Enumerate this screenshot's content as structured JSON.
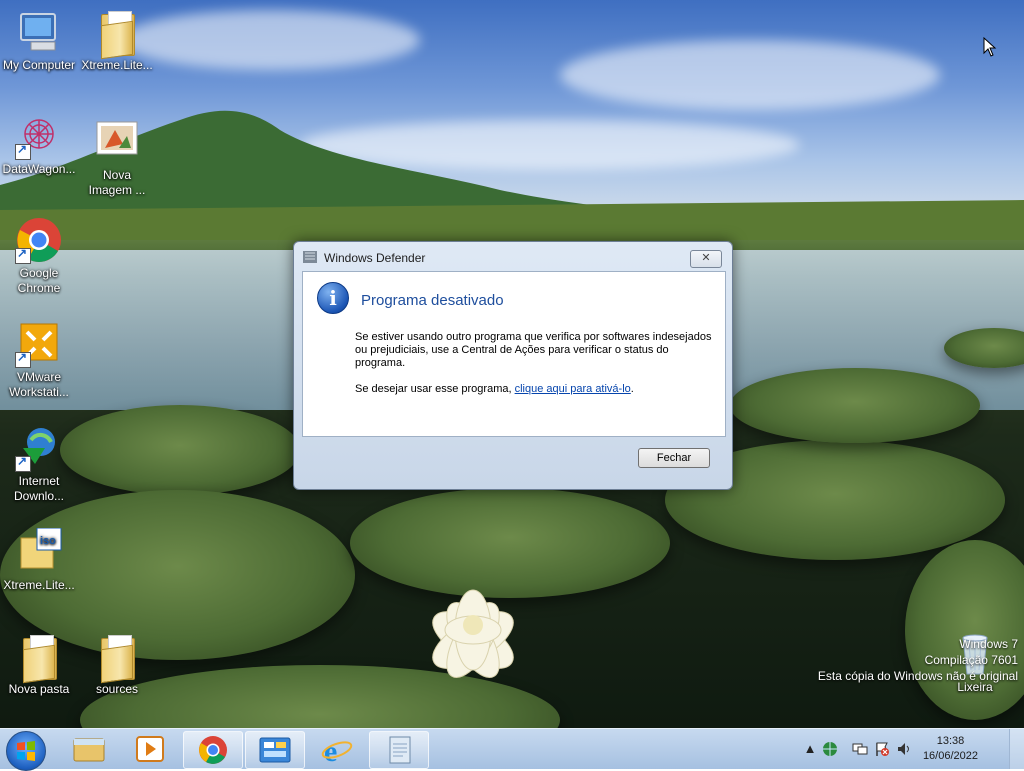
{
  "desktop": {
    "icons": [
      {
        "label": "My Computer"
      },
      {
        "label": "Xtreme.Lite..."
      },
      {
        "label": "DataWagon..."
      },
      {
        "label": "Nova\nImagem ..."
      },
      {
        "label": "Google\nChrome"
      },
      {
        "label": "VMware\nWorkstati..."
      },
      {
        "label": "Internet\nDownlo..."
      },
      {
        "label": "Xtreme.Lite..."
      },
      {
        "label": "Nova pasta"
      },
      {
        "label": "sources"
      },
      {
        "label": "Lixeira"
      }
    ]
  },
  "watermark": {
    "line1": "Windows 7",
    "line2": "Compilação 7601",
    "line3": "Esta cópia do Windows não é original"
  },
  "dialog": {
    "title": "Windows Defender",
    "close_glyph": "✕",
    "heading": "Programa desativado",
    "message": "Se estiver usando outro programa que verifica por softwares indesejados ou prejudiciais, use a Central de Ações para verificar o status do programa.",
    "message2_prefix": "Se desejar usar esse programa, ",
    "link": "clique aqui para ativá-lo",
    "message2_suffix": ".",
    "button": "Fechar"
  },
  "taskbar": {
    "start_icon": "windows-logo-icon",
    "apps": [
      "file-explorer-icon",
      "media-player-icon",
      "chrome-icon",
      "control-panel-icon",
      "internet-explorer-icon",
      "document-icon"
    ],
    "clock": {
      "time": "13:38",
      "date": "16/06/2022"
    },
    "tray": [
      "show-hidden-icons-icon",
      "network-globe-icon",
      "display-icon",
      "action-center-flag-icon",
      "volume-icon"
    ]
  },
  "colors": {
    "heading": "#1e4e9d",
    "link": "#0645ad"
  }
}
